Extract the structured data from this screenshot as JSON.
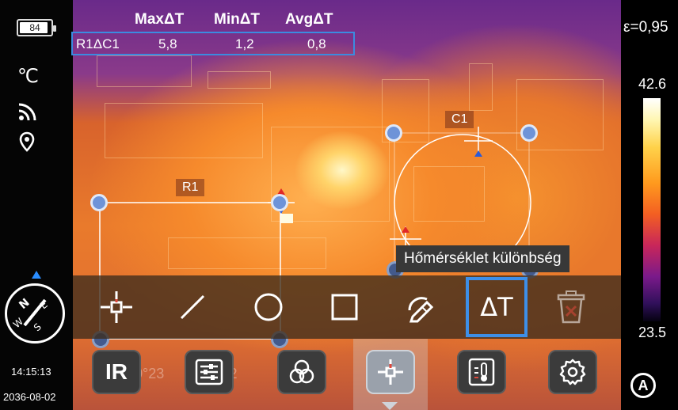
{
  "status": {
    "battery_level": "84",
    "unit": "℃",
    "wifi_icon": "wifi-icon",
    "location_icon": "location-pin-icon",
    "compass_icon": "compass-icon",
    "time": "14:15:13",
    "date": "2036-08-02"
  },
  "measurements_table": {
    "headers": [
      "MaxΔT",
      "MinΔT",
      "AvgΔT"
    ],
    "row_label": "R1ΔC1",
    "values": [
      "5,8",
      "1,2",
      "0,8"
    ]
  },
  "thermal": {
    "emissivity": "ε=0,95",
    "scale_max": "42.6",
    "scale_min": "23.5",
    "palette": "iron",
    "auto_mode_label": "A"
  },
  "overlays": {
    "rect_label": "R1",
    "circle_label": "C1"
  },
  "toolbar": {
    "tools": [
      {
        "name": "point-tool",
        "icon": "crosshair-point-icon"
      },
      {
        "name": "line-tool",
        "icon": "line-icon"
      },
      {
        "name": "circle-tool",
        "icon": "circle-icon"
      },
      {
        "name": "rectangle-tool",
        "icon": "square-icon"
      },
      {
        "name": "freehand-tool",
        "icon": "pen-icon"
      },
      {
        "name": "delta-t-tool",
        "icon": "delta-t-icon",
        "label": "ΔT",
        "selected": true
      },
      {
        "name": "delete-tool",
        "icon": "trash-icon"
      }
    ],
    "tooltip": "Hőmérséklet különbség"
  },
  "bottom_bar": {
    "ir_label": "IR",
    "buttons": [
      "ir-mode",
      "adjust-sliders",
      "image-blend",
      "measure-tools",
      "thermometer-alarm",
      "settings"
    ],
    "active": "measure-tools"
  },
  "colors": {
    "accent_blue": "#3d8fe8",
    "handle_blue": "#6e93d8",
    "tooltip_bg": "#383838",
    "delete_red": "#e0483c"
  }
}
